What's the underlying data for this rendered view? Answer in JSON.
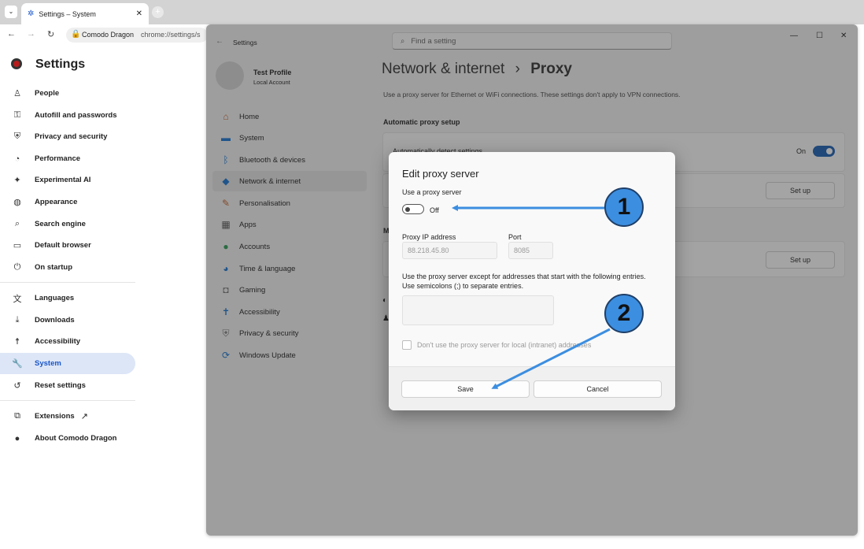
{
  "browser": {
    "tab_title": "Settings – System",
    "site_chip": "Comodo Dragon",
    "url": "chrome://settings/s"
  },
  "chrome_settings": {
    "title": "Settings",
    "items": [
      {
        "label": "People",
        "icon": "person-icon"
      },
      {
        "label": "Autofill and passwords",
        "icon": "key-icon"
      },
      {
        "label": "Privacy and security",
        "icon": "shield-icon"
      },
      {
        "label": "Performance",
        "icon": "gauge-icon"
      },
      {
        "label": "Experimental AI",
        "icon": "sparkle-icon"
      },
      {
        "label": "Appearance",
        "icon": "palette-icon"
      },
      {
        "label": "Search engine",
        "icon": "search-icon"
      },
      {
        "label": "Default browser",
        "icon": "browser-icon"
      },
      {
        "label": "On startup",
        "icon": "power-icon"
      },
      {
        "label": "Languages",
        "icon": "translate-icon"
      },
      {
        "label": "Downloads",
        "icon": "download-icon"
      },
      {
        "label": "Accessibility",
        "icon": "accessibility-icon"
      },
      {
        "label": "System",
        "icon": "wrench-icon"
      },
      {
        "label": "Reset settings",
        "icon": "reset-icon"
      },
      {
        "label": "Extensions",
        "icon": "puzzle-icon"
      },
      {
        "label": "About Comodo Dragon",
        "icon": "dragon-icon"
      }
    ]
  },
  "win_settings": {
    "title": "Settings",
    "search_placeholder": "Find a setting",
    "profile_name": "Test Profile",
    "profile_sub": "Local Account",
    "nav": [
      {
        "label": "Home"
      },
      {
        "label": "System"
      },
      {
        "label": "Bluetooth & devices"
      },
      {
        "label": "Network & internet"
      },
      {
        "label": "Personalisation"
      },
      {
        "label": "Apps"
      },
      {
        "label": "Accounts"
      },
      {
        "label": "Time & language"
      },
      {
        "label": "Gaming"
      },
      {
        "label": "Accessibility"
      },
      {
        "label": "Privacy & security"
      },
      {
        "label": "Windows Update"
      }
    ],
    "breadcrumb_parent": "Network & internet",
    "breadcrumb_sep": "›",
    "breadcrumb_current": "Proxy",
    "description": "Use a proxy server for Ethernet or WiFi connections. These settings don't apply to VPN connections.",
    "auto_heading": "Automatic proxy setup",
    "auto_detect_label": "Automatically detect settings",
    "auto_detect_state": "On",
    "manual_heading_partial": "M",
    "setup_label": "Set up",
    "setup_label2": "Set up"
  },
  "dialog": {
    "title": "Edit proxy server",
    "use_proxy_label": "Use a proxy server",
    "toggle_state": "Off",
    "ip_label": "Proxy IP address",
    "ip_value": "88.218.45.80",
    "port_label": "Port",
    "port_value": "8085",
    "exceptions_text_1": "Use the proxy server except for addresses that start with the following entries.",
    "exceptions_text_2": "Use semicolons (;) to separate entries.",
    "local_checkbox_label": "Don't use the proxy server for local (intranet) addresses",
    "save_label": "Save",
    "cancel_label": "Cancel"
  },
  "annotations": {
    "badge1": "1",
    "badge2": "2",
    "color": "#3c8ee0"
  }
}
